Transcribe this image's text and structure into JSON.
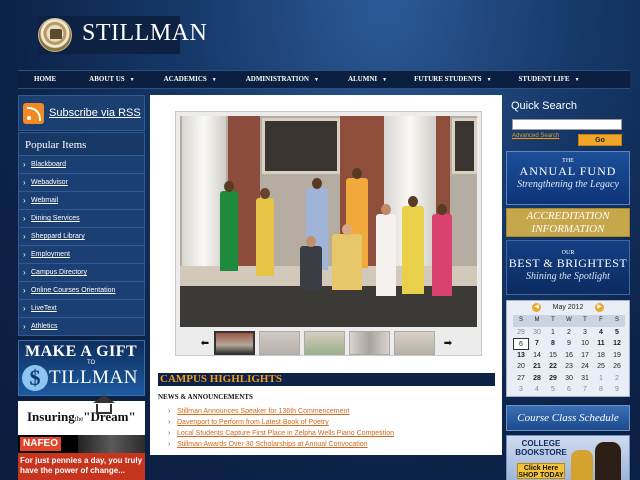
{
  "header": {
    "brand": "STILLMAN"
  },
  "nav": {
    "items": [
      {
        "label": "HOME",
        "has_menu": false
      },
      {
        "label": "ABOUT US",
        "has_menu": true
      },
      {
        "label": "ACADEMICS",
        "has_menu": true
      },
      {
        "label": "ADMINISTRATION",
        "has_menu": true
      },
      {
        "label": "ALUMNI",
        "has_menu": true
      },
      {
        "label": "FUTURE STUDENTS",
        "has_menu": true
      },
      {
        "label": "STUDENT LIFE",
        "has_menu": true
      }
    ]
  },
  "left": {
    "rss_label": "Subscribe via RSS",
    "popular_title": "Popular Items",
    "popular": [
      "Blackboard",
      "Webadvisor",
      "Webmail",
      "Dining Services",
      "Sheppard Library",
      "Employment",
      "Campus Directory",
      "Online Courses Orientation",
      "LiveText",
      "Athletics"
    ],
    "gift": {
      "line1": "MAKE A GIFT",
      "to": "TO",
      "coin": "$",
      "name": "TILLMAN"
    },
    "dream": {
      "insuring": "Insuring",
      "the": "the",
      "dream": "\"Dream\""
    },
    "nafeo": "NAFEO",
    "pennies": "For just pennies a day, you truly have the power of change..."
  },
  "main": {
    "highlights_title": "CAMPUS HIGHLIGHTS",
    "news_head": "NEWS & ANNOUNCEMENTS",
    "news": [
      "Stillman Announces Speaker for 136th Commencement",
      "Davenport to Perform from Latest Book of Poetry",
      "Local Students Capture First Place in Zelpha Wells Piano Competition",
      "Stillman Awards Over 30 Scholarships at Annual Convocation"
    ],
    "prev_arrow": "⬅",
    "next_arrow": "➡"
  },
  "right": {
    "quick_search": "Quick Search",
    "advanced": "Advanced Search",
    "go": "Go",
    "fund": {
      "the": "THE",
      "title": "ANNUAL FUND",
      "sub": "Strengthening the Legacy"
    },
    "accreditation": "ACCREDITATION INFORMATION",
    "bright": {
      "our": "OUR",
      "title": "BEST & BRIGHTEST",
      "sub": "Shining the Spotlight"
    },
    "calendar": {
      "title": "May 2012",
      "dow": [
        "S",
        "M",
        "T",
        "W",
        "T",
        "F",
        "S"
      ],
      "rows": [
        [
          "29",
          "30",
          "1",
          "2",
          "3",
          "4",
          "5"
        ],
        [
          "6",
          "7",
          "8",
          "9",
          "10",
          "11",
          "12"
        ],
        [
          "13",
          "14",
          "15",
          "16",
          "17",
          "18",
          "19"
        ],
        [
          "20",
          "21",
          "22",
          "23",
          "24",
          "25",
          "26"
        ],
        [
          "27",
          "28",
          "29",
          "30",
          "31",
          "1",
          "2"
        ],
        [
          "3",
          "4",
          "5",
          "6",
          "7",
          "8",
          "9"
        ]
      ],
      "today": "6",
      "bold_days": [
        "4",
        "5",
        "7",
        "8",
        "11",
        "12",
        "13",
        "21",
        "22",
        "28",
        "29"
      ]
    },
    "course": "Course Class Schedule",
    "bookstore": {
      "title": "COLLEGE BOOKSTORE",
      "click": "Click Here SHOP TODAY"
    }
  }
}
